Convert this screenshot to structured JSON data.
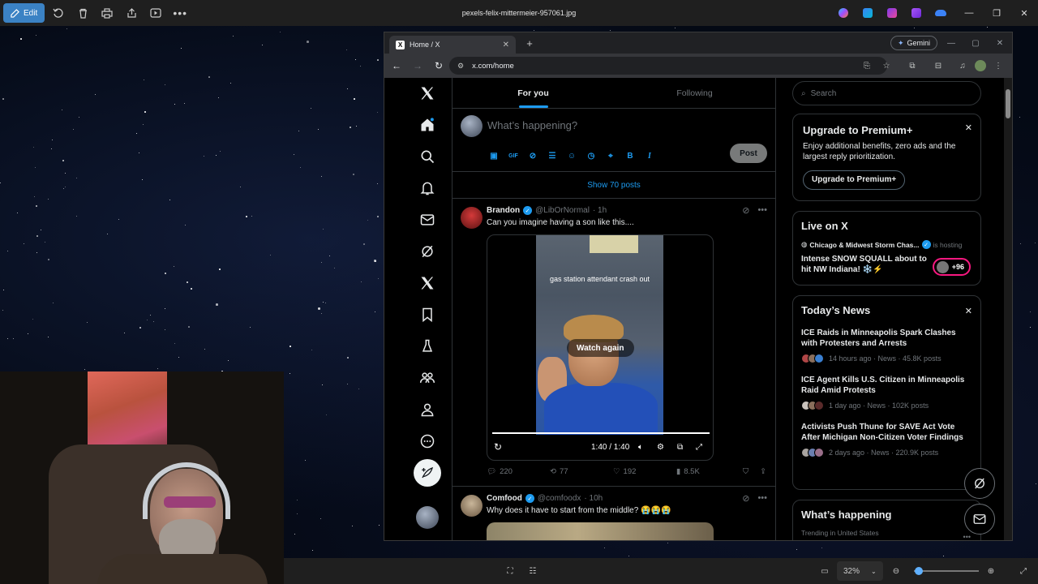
{
  "viewer": {
    "edit_label": "Edit",
    "filename": "pexels-felix-mittermeier-957061.jpg",
    "zoom": "32%",
    "zoom_fraction": 0.08
  },
  "browser": {
    "tab_title": "Home / X",
    "tab_favicon": "X",
    "gemini_label": "Gemini",
    "url": "x.com/home"
  },
  "feed": {
    "tabs": [
      "For you",
      "Following"
    ],
    "composer_placeholder": "What’s happening?",
    "post_button": "Post",
    "show_posts": "Show 70 posts"
  },
  "tweets": [
    {
      "name": "Brandon",
      "handle": "@LibOrNormal",
      "time": "· 1h",
      "text": "Can you imagine having a son like this....",
      "video_caption": "gas station attendant crash out",
      "watch_again": "Watch again",
      "video_time": "1:40 / 1:40",
      "replies": "220",
      "reposts": "77",
      "likes": "192",
      "views": "8.5K"
    },
    {
      "name": "Comfood",
      "handle": "@comfoodx",
      "time": "· 10h",
      "text": "Why does it have to start from the middle? 😭😭😭"
    }
  ],
  "sidebar": {
    "search_placeholder": "Search",
    "premium": {
      "title": "Upgrade to Premium+",
      "description": "Enjoy additional benefits, zero ads and the largest reply prioritization.",
      "button": "Upgrade to Premium+"
    },
    "live": {
      "title": "Live on X",
      "host": "Chicago & Midwest Storm Chas...",
      "host_status": "is hosting",
      "stream_title": "Intense SNOW SQUALL about to hit NW Indiana! ❄️⚡",
      "listeners": "+96"
    },
    "news": {
      "title": "Today’s News",
      "items": [
        {
          "title": "ICE Raids in Minneapolis Spark Clashes with Protesters and Arrests",
          "meta": "14 hours ago · News · 45.8K posts"
        },
        {
          "title": "ICE Agent Kills U.S. Citizen in Minneapolis Raid Amid Protests",
          "meta": "1 day ago · News · 102K posts"
        },
        {
          "title": "Activists Push Thune for SAVE Act Vote After Michigan Non-Citizen Voter Findings",
          "meta": "2 days ago · News · 220.9K posts"
        }
      ]
    },
    "happening": {
      "title": "What’s happening",
      "subtitle": "Trending in United States"
    }
  },
  "colors": {
    "accent": "#1d9bf0",
    "live_ring": "#f91880",
    "edit_button": "#3b82c4"
  }
}
